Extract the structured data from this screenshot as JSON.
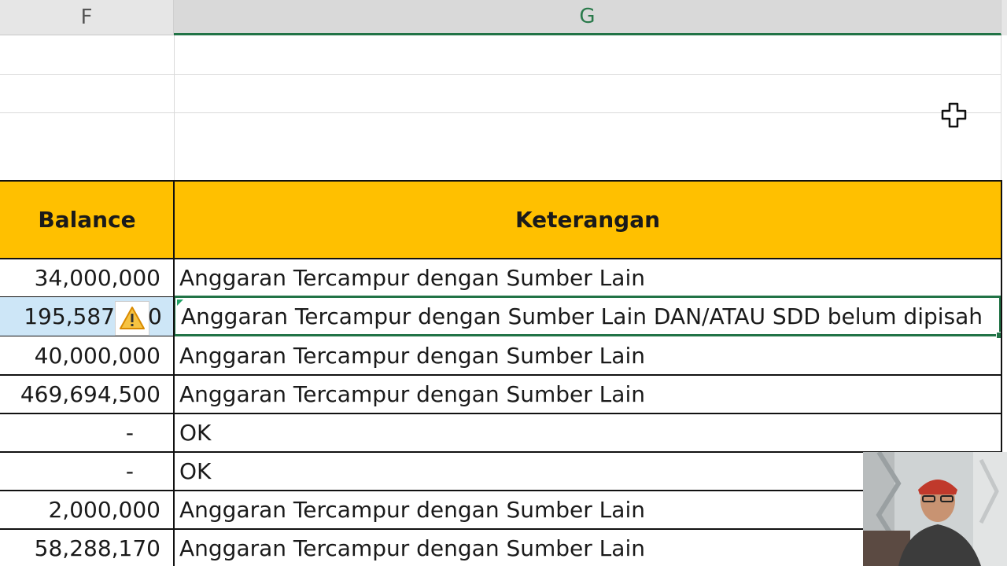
{
  "columns": {
    "f": "F",
    "g": "G"
  },
  "table": {
    "headers": {
      "balance": "Balance",
      "keterangan": "Keterangan"
    },
    "rows": [
      {
        "balance": "34,000,000",
        "keterangan": "Anggaran Tercampur dengan Sumber Lain"
      },
      {
        "balance_left": "195,587",
        "balance_right": "0",
        "keterangan": "Anggaran Tercampur dengan Sumber Lain DAN/ATAU SDD belum dipisah"
      },
      {
        "balance": "40,000,000",
        "keterangan": "Anggaran Tercampur dengan Sumber Lain"
      },
      {
        "balance": "469,694,500",
        "keterangan": "Anggaran Tercampur dengan Sumber Lain"
      },
      {
        "balance": "-",
        "keterangan": "OK"
      },
      {
        "balance": "-",
        "keterangan": "OK"
      },
      {
        "balance": "2,000,000",
        "keterangan": "Anggaran Tercampur dengan Sumber Lain"
      },
      {
        "balance": "58,288,170",
        "keterangan": "Anggaran Tercampur dengan Sumber Lain"
      }
    ]
  },
  "colors": {
    "header_fill": "#ffc000",
    "selection_border": "#217346",
    "selected_row": "#cde6f7"
  },
  "icons": {
    "warning": "warning-icon",
    "cursor": "cell-select-cursor-icon"
  }
}
